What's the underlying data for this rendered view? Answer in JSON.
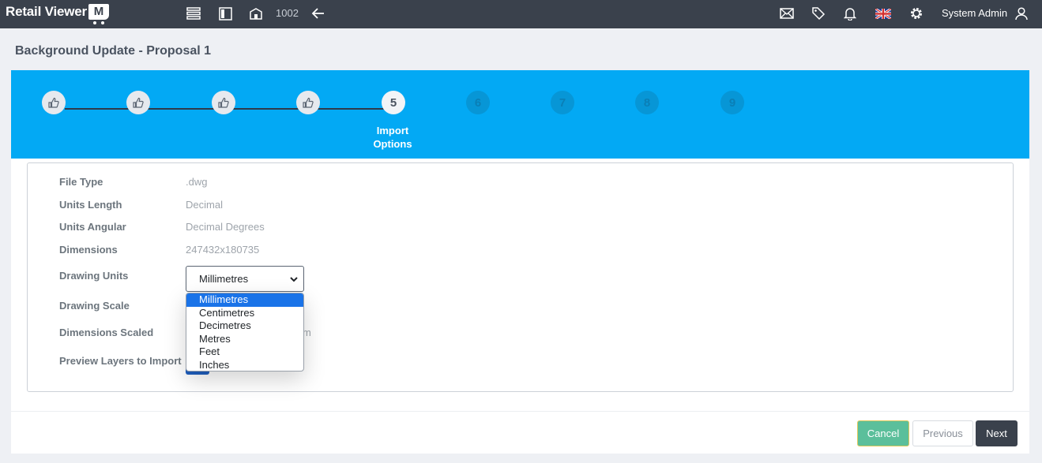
{
  "app": {
    "brand_text": "Retail Viewer",
    "brand_badge": "M"
  },
  "topbar": {
    "code": "1002",
    "user_name": "System Admin",
    "icons": [
      "list-icon",
      "sidebar-icon",
      "store-icon",
      "back-arrow-icon",
      "mail-icon",
      "tag-icon",
      "bell-icon",
      "uk-flag-icon",
      "gear-icon",
      "user-icon"
    ]
  },
  "page": {
    "title": "Background Update - Proposal 1"
  },
  "stepper": {
    "steps": [
      {
        "label": "",
        "state": "done"
      },
      {
        "label": "",
        "state": "done"
      },
      {
        "label": "",
        "state": "done"
      },
      {
        "label": "",
        "state": "done"
      },
      {
        "label": "5",
        "state": "active"
      },
      {
        "label": "6",
        "state": "future"
      },
      {
        "label": "7",
        "state": "future"
      },
      {
        "label": "8",
        "state": "future"
      },
      {
        "label": "9",
        "state": "future"
      }
    ],
    "active_title_line1": "Import",
    "active_title_line2": "Options"
  },
  "form": {
    "file_type_label": "File Type",
    "file_type_value": ".dwg",
    "units_length_label": "Units Length",
    "units_length_value": "Decimal",
    "units_angular_label": "Units Angular",
    "units_angular_value": "Decimal Degrees",
    "dimensions_label": "Dimensions",
    "dimensions_value": "247432x180735",
    "drawing_units_label": "Drawing Units",
    "drawing_units_value": "Millimetres",
    "drawing_units_options": [
      "Millimetres",
      "Centimetres",
      "Decimetres",
      "Metres",
      "Feet",
      "Inches"
    ],
    "drawing_scale_label": "Drawing Scale",
    "dimensions_scaled_label": "Dimensions Scaled",
    "dimensions_scaled_partial": "m",
    "preview_layers_label": "Preview Layers to Import"
  },
  "footer": {
    "cancel": "Cancel",
    "previous": "Previous",
    "next": "Next"
  },
  "colors": {
    "topbar": "#3a414c",
    "stepper": "#03a9f4",
    "cancel": "#5bbf9b",
    "next": "#3a414c",
    "selected_option": "#1a73e8"
  }
}
